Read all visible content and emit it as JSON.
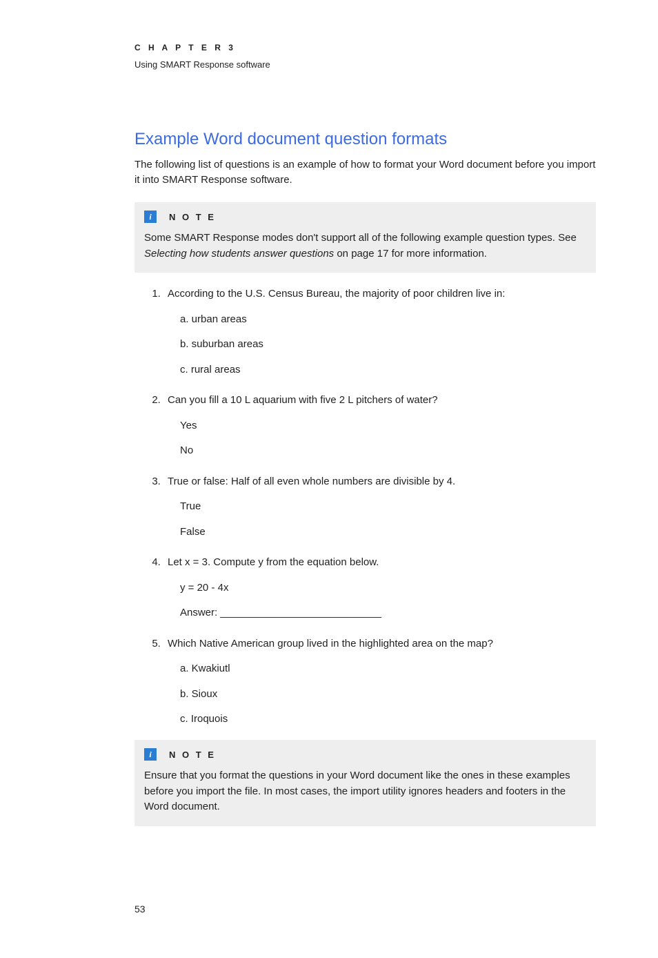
{
  "header": {
    "chapter_label": "C H A P T E R   3",
    "chapter_subtitle": "Using SMART Response software"
  },
  "heading": "Example Word document question formats",
  "intro": "The following list of questions is an example of how to format your Word document before you import it into SMART Response software.",
  "note1": {
    "label": "N O T E",
    "body_pre": "Some SMART Response modes don't support all of the following example question types. See ",
    "body_italic": "Selecting how students answer questions",
    "body_post": " on page 17 for more information."
  },
  "questions": [
    {
      "text": "According to the U.S. Census Bureau, the majority of poor children live in:",
      "options": [
        "a. urban areas",
        "b. suburban areas",
        "c. rural areas"
      ]
    },
    {
      "text": "Can you fill a 10 L aquarium with five 2 L pitchers of water?",
      "options": [
        "Yes",
        "No"
      ]
    },
    {
      "text": "True or false: Half of all even whole numbers are divisible by 4.",
      "options": [
        "True",
        "False"
      ]
    },
    {
      "text": "Let x = 3. Compute y from the equation below.",
      "options": [
        "y = 20 - 4x",
        "Answer: ____________________________"
      ]
    },
    {
      "text": "Which Native American group lived in the highlighted area on the map?",
      "options": [
        "a. Kwakiutl",
        "b. Sioux",
        "c. Iroquois"
      ]
    }
  ],
  "note2": {
    "label": "N O T E",
    "body": "Ensure that you format the questions in your Word document like the ones in these examples before you import the file. In most cases, the import utility ignores headers and footers in the Word document."
  },
  "page_number": "53"
}
